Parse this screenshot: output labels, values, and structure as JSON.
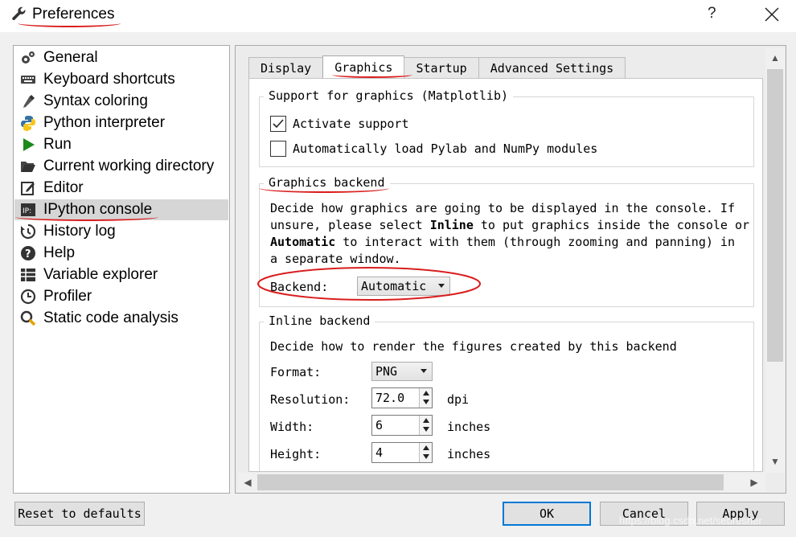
{
  "window": {
    "title": "Preferences",
    "help_label": "?"
  },
  "sidebar": {
    "items": [
      {
        "label": "General",
        "icon": "gears-icon"
      },
      {
        "label": "Keyboard shortcuts",
        "icon": "keyboard-icon"
      },
      {
        "label": "Syntax coloring",
        "icon": "eyedropper-icon"
      },
      {
        "label": "Python interpreter",
        "icon": "python-icon"
      },
      {
        "label": "Run",
        "icon": "play-icon"
      },
      {
        "label": "Current working directory",
        "icon": "folder-open-icon"
      },
      {
        "label": "Editor",
        "icon": "edit-icon"
      },
      {
        "label": "IPython console",
        "icon": "ipython-icon",
        "selected": true
      },
      {
        "label": "History log",
        "icon": "history-icon"
      },
      {
        "label": "Help",
        "icon": "question-icon"
      },
      {
        "label": "Variable explorer",
        "icon": "table-icon"
      },
      {
        "label": "Profiler",
        "icon": "clock-icon"
      },
      {
        "label": "Static code analysis",
        "icon": "magnifier-icon"
      }
    ]
  },
  "tabs": [
    {
      "label": "Display"
    },
    {
      "label": "Graphics",
      "active": true
    },
    {
      "label": "Startup"
    },
    {
      "label": "Advanced Settings"
    }
  ],
  "support": {
    "title": "Support for graphics (Matplotlib)",
    "activate_label": "Activate support",
    "activate_checked": true,
    "pylab_label": "Automatically load Pylab and NumPy modules",
    "pylab_checked": false
  },
  "backend": {
    "title": "Graphics backend",
    "desc_1": "Decide how graphics are going to be displayed in the console. If",
    "desc_2a": "unsure, please select ",
    "desc_2b": "Inline",
    "desc_2c": " to put graphics inside the console or",
    "desc_3a": "Automatic",
    "desc_3b": " to interact with them (through zooming and panning) in",
    "desc_4": "a separate window.",
    "label": "Backend:",
    "value": "Automatic"
  },
  "inline": {
    "title": "Inline backend",
    "desc": "Decide how to render the figures created by this backend",
    "format_label": "Format:",
    "format_value": "PNG",
    "resolution_label": "Resolution:",
    "resolution_value": "72.0",
    "resolution_unit": "dpi",
    "width_label": "Width:",
    "width_value": "6",
    "width_unit": "inches",
    "height_label": "Height:",
    "height_value": "4",
    "height_unit": "inches"
  },
  "buttons": {
    "reset": "Reset to defaults",
    "ok": "OK",
    "cancel": "Cancel",
    "apply": "Apply"
  },
  "watermark": "https://blog.csdn.net/sebresher",
  "colors": {
    "annotation_red": "#d91e1e",
    "selected_bg": "#d6d6d6",
    "focus_blue": "#0078d7"
  }
}
